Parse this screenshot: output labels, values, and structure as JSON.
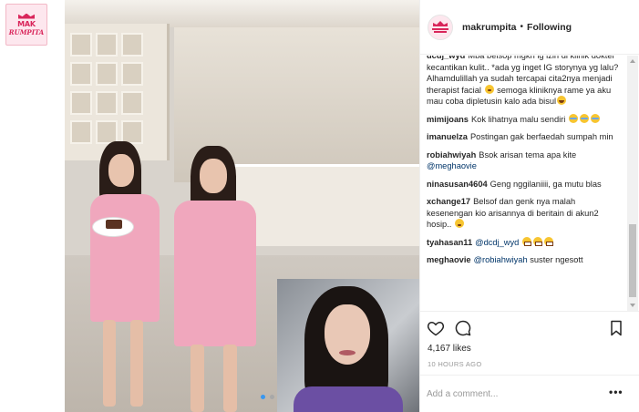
{
  "brand": {
    "logo_line1": "MAK",
    "logo_line2": "RUMPITA"
  },
  "header": {
    "username": "makrumpita",
    "separator": "•",
    "follow_status": "Following"
  },
  "comments": [
    {
      "user": "dcdj_wyd",
      "parts": [
        {
          "t": "Mba belsop mgkn ig izin di klinik dokter kecantikan kulit.. *ada yg inget IG storynya yg lalu? Alhamdulillah ya sudah tercapai cita2nya menjadi therapist facial "
        },
        {
          "emoji": "blush"
        },
        {
          "t": " semoga kliniknya rame ya aku mau coba dipletusin kalo ada bisul"
        },
        {
          "emoji": "laugh"
        }
      ]
    },
    {
      "user": "mimijoans",
      "parts": [
        {
          "t": "Kok lihatnya malu sendiri "
        },
        {
          "emoji": "sweat"
        },
        {
          "emoji": "sweat"
        },
        {
          "emoji": "sweat"
        }
      ]
    },
    {
      "user": "imanuelza",
      "parts": [
        {
          "t": "Postingan gak berfaedah sumpah min"
        }
      ]
    },
    {
      "user": "robiahwiyah",
      "parts": [
        {
          "t": "Bsok arisan tema apa kite "
        },
        {
          "mention": "@meghaovie"
        }
      ]
    },
    {
      "user": "ninasusan4604",
      "parts": [
        {
          "t": "Geng nggilaniiii, ga mutu blas"
        }
      ]
    },
    {
      "user": "xchange17",
      "parts": [
        {
          "t": "Belsof dan genk nya malah kesenengan kio arisannya di beritain di akun2 hosip.. "
        },
        {
          "emoji": "dizzy"
        }
      ]
    },
    {
      "user": "tyahasan11",
      "parts": [
        {
          "mention": "@dcdj_wyd"
        },
        {
          "t": " "
        },
        {
          "emoji": "grimace"
        },
        {
          "emoji": "grimace"
        },
        {
          "emoji": "grimace"
        }
      ]
    },
    {
      "user": "meghaovie",
      "parts": [
        {
          "mention": "@robiahwiyah"
        },
        {
          "t": " suster ngesott"
        }
      ]
    }
  ],
  "post": {
    "likes": "4,167 likes",
    "time_ago": "10 HOURS AGO"
  },
  "add_comment": {
    "placeholder": "Add a comment..."
  },
  "more_options_label": "•••",
  "icons": [
    "heart-icon",
    "comment-icon",
    "bookmark-icon",
    "scroll-up-icon",
    "scroll-down-icon"
  ],
  "colors": {
    "mention": "#003569",
    "accent": "#3897f0",
    "brand_pink": "#d9265b"
  }
}
